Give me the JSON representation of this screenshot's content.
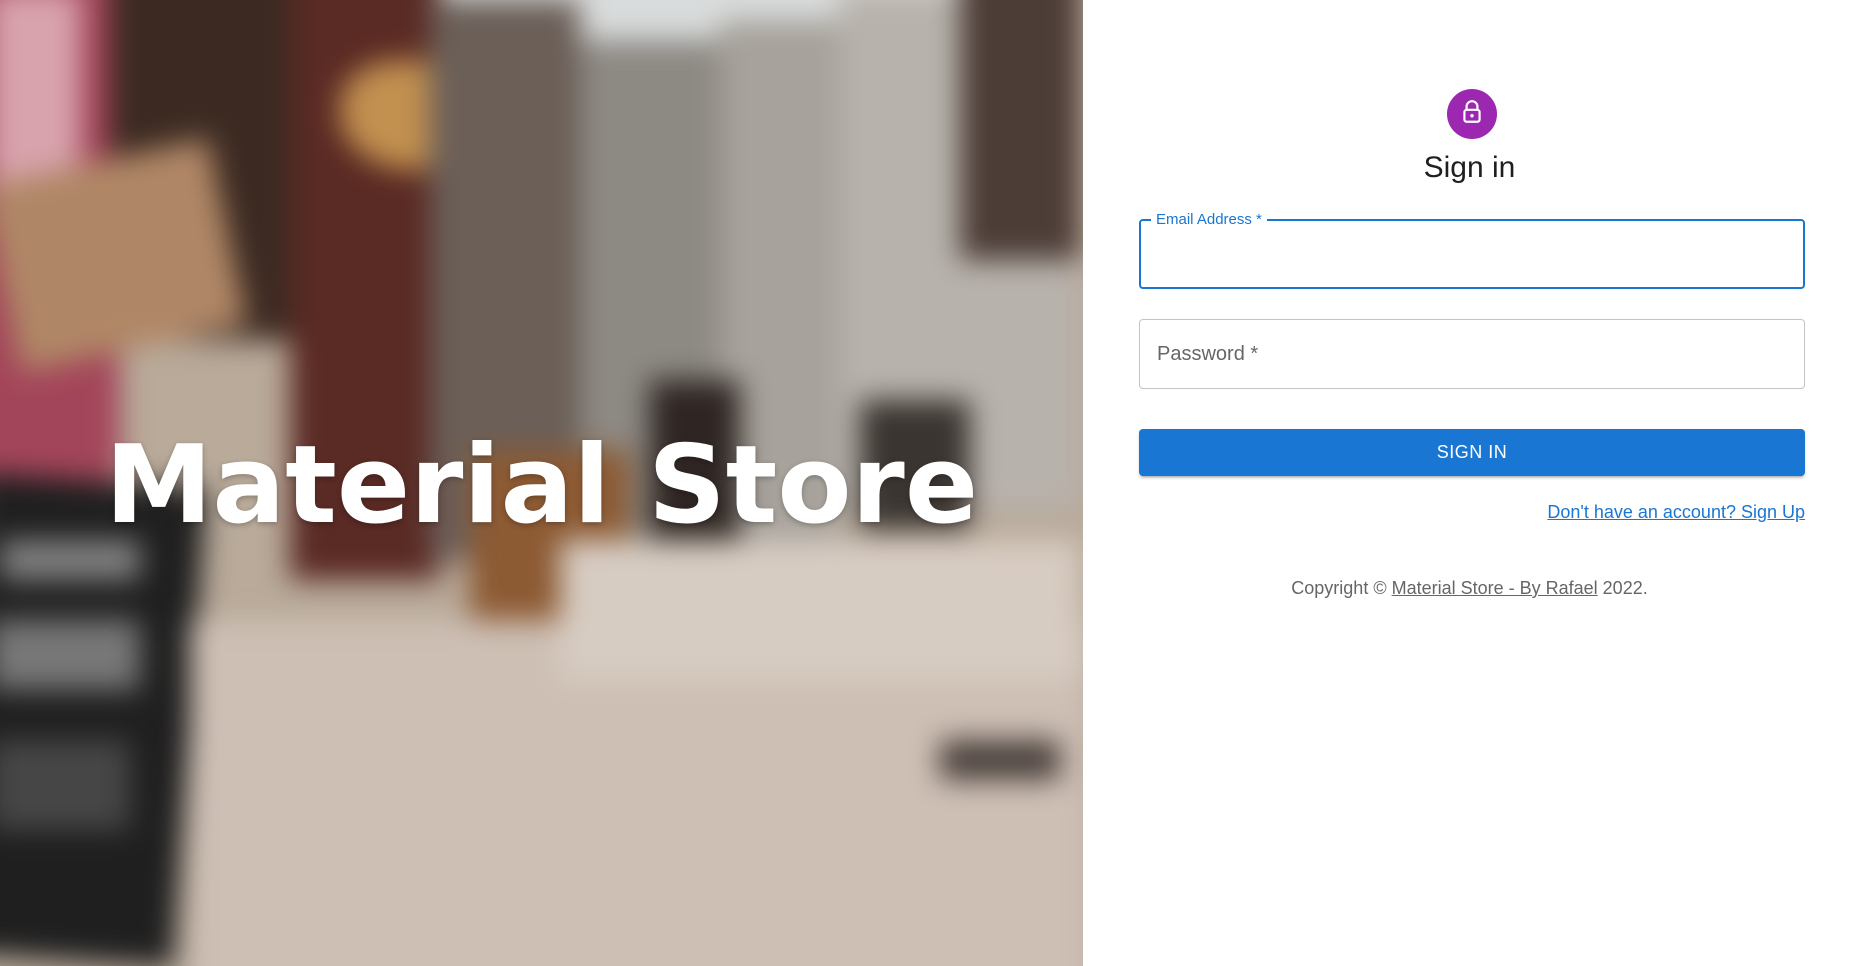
{
  "hero": {
    "title": "Material Store"
  },
  "signin": {
    "avatar_icon": "lock-icon",
    "avatar_color": "#9c27b0",
    "title": "Sign in",
    "email_label": "Email Address *",
    "email_value": "",
    "password_label": "Password *",
    "password_value": "",
    "button_label": "SIGN IN",
    "signup_link": "Don't have an account? Sign Up"
  },
  "footer": {
    "copyright_prefix": "Copyright © ",
    "brand_link": "Material Store - By Rafael",
    "copyright_suffix": " 2022."
  },
  "colors": {
    "primary": "#1976d2",
    "secondary": "#9c27b0"
  }
}
